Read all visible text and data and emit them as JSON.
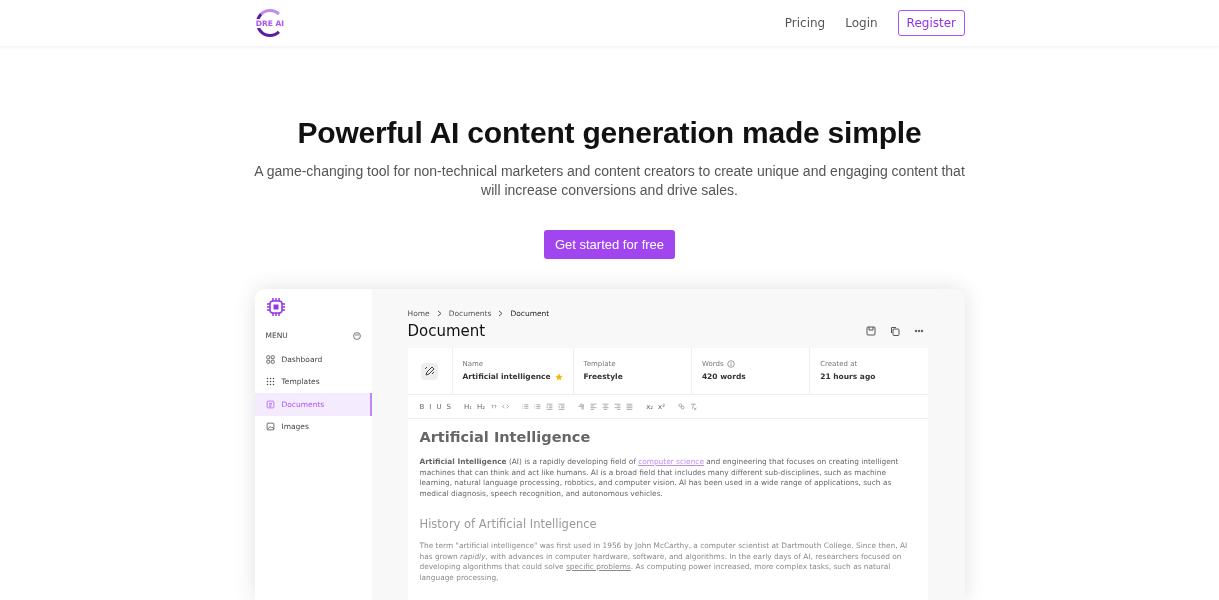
{
  "header": {
    "logo_text": "DRE AI",
    "nav": [
      {
        "label": "Pricing",
        "kind": "link"
      },
      {
        "label": "Login",
        "kind": "link"
      },
      {
        "label": "Register",
        "kind": "outline"
      }
    ]
  },
  "hero": {
    "title": "Powerful AI content generation made simple",
    "subtitle": "A game-changing tool for non-technical marketers and content creators to create unique and engaging content that will increase conversions and drive sales.",
    "cta": "Get started for free"
  },
  "app": {
    "sidebar": {
      "menu_label": "MENU",
      "items": [
        {
          "label": "Dashboard",
          "selected": false
        },
        {
          "label": "Templates",
          "selected": false
        },
        {
          "label": "Documents",
          "selected": true
        },
        {
          "label": "Images",
          "selected": false
        }
      ]
    },
    "breadcrumb": [
      "Home",
      "Documents",
      "Document"
    ],
    "title": "Document",
    "info": [
      {
        "label": "Name",
        "value": "Artificial intelligence",
        "starred": true,
        "info": false
      },
      {
        "label": "Template",
        "value": "Freestyle",
        "starred": false,
        "info": false
      },
      {
        "label": "Words",
        "value": "420 words",
        "starred": false,
        "info": true
      },
      {
        "label": "Created at",
        "value": "21 hours ago",
        "starred": false,
        "info": false
      }
    ],
    "toolbar": [
      [
        {
          "label": "B"
        },
        {
          "label": "I"
        },
        {
          "label": "U"
        },
        {
          "label": "S"
        }
      ],
      [
        {
          "label": "H₁"
        },
        {
          "label": "H₂"
        },
        {
          "kind": "quote"
        },
        {
          "kind": "code"
        }
      ],
      [
        {
          "kind": "ol"
        },
        {
          "kind": "ul"
        },
        {
          "kind": "outdent"
        },
        {
          "kind": "indent"
        }
      ],
      [
        {
          "kind": "para"
        },
        {
          "kind": "left"
        },
        {
          "kind": "center"
        },
        {
          "kind": "right"
        },
        {
          "kind": "justify"
        }
      ],
      [
        {
          "label": "x₂"
        },
        {
          "label": "x²"
        }
      ],
      [
        {
          "kind": "link"
        },
        {
          "kind": "clear"
        }
      ]
    ],
    "content": [
      {
        "kind": "h1",
        "text": "Artificial Intelligence"
      },
      {
        "kind": "p",
        "before": "**Artificial Intelligence** (AI) is a rapidly developing field of ",
        "link": "computer science",
        "after": " and engineering that focuses on creating intelligent machines that can think and act like humans. AI is a broad field that includes many different sub-disciplines, such as machine learning, natural language processing, robotics, and computer vision. AI has been used in a wide range of applications, such as medical diagnosis, speech recognition, and autonomous vehicles."
      },
      {
        "kind": "h2",
        "text": "History of Artificial Intelligence"
      },
      {
        "kind": "p",
        "before": "The term \"artificial intelligence\" was first used in 1956 by John McCarthy, a computer scientist at Dartmouth College. Since then, AI has grown *rapidly*, with advances in computer hardware, software, and algorithms. In the early days of AI, researchers focused on developing algorithms that could solve ",
        "link": "specific problems",
        "after": ". As computing power increased, more complex tasks, such as natural language processing,"
      }
    ]
  }
}
